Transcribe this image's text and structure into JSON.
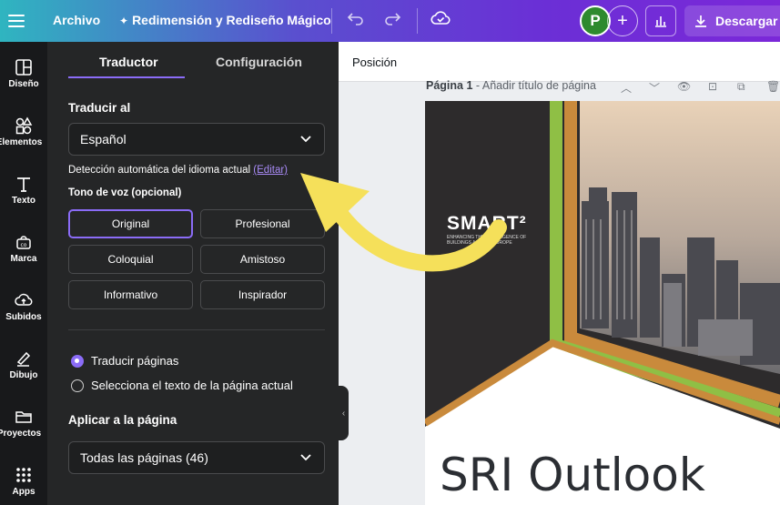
{
  "topbar": {
    "file_label": "Archivo",
    "magic_label": "Redimensión y Rediseño Mágico",
    "avatar_initial": "P",
    "download_label": "Descargar"
  },
  "rail": [
    {
      "label": "Diseño",
      "icon": "layout-icon"
    },
    {
      "label": "Elementos",
      "icon": "shapes-icon"
    },
    {
      "label": "Texto",
      "icon": "text-icon"
    },
    {
      "label": "Marca",
      "icon": "brand-icon"
    },
    {
      "label": "Subidos",
      "icon": "upload-cloud-icon"
    },
    {
      "label": "Dibujo",
      "icon": "pen-icon"
    },
    {
      "label": "Proyectos",
      "icon": "folder-icon"
    },
    {
      "label": "Apps",
      "icon": "apps-grid-icon"
    }
  ],
  "panel": {
    "tabs": [
      "Traductor",
      "Configuración"
    ],
    "active_tab": "Traductor",
    "translate_to_label": "Traducir al",
    "language_value": "Español",
    "detect_text": "Detección automática del idioma actual",
    "detect_link": "(Editar)",
    "tone_label": "Tono de voz (opcional)",
    "tones": [
      "Original",
      "Profesional",
      "Coloquial",
      "Amistoso",
      "Informativo",
      "Inspirador"
    ],
    "active_tone": "Original",
    "radio_options": [
      "Traducir páginas",
      "Selecciona el texto de la página actual"
    ],
    "radio_selected": "Traducir páginas",
    "apply_label": "Aplicar a la página",
    "apply_value": "Todas las páginas (46)"
  },
  "canvas": {
    "position_label": "Posición",
    "page_label": "Página 1",
    "page_title_placeholder": "- Añadir título de página",
    "slide_logo": "SMART²",
    "slide_logo_sub": "ENHANCING THE INTELLIGENCE OF BUILDINGS ACROSS EUROPE",
    "slide_title": "SRI Outlook"
  },
  "colors": {
    "accent": "#8b6cf7",
    "panel_bg": "#252627",
    "arrow": "#f5e05a",
    "slide_green": "#8fbf45",
    "slide_orange": "#c98a3c",
    "slide_dark": "#2d2b2c"
  }
}
